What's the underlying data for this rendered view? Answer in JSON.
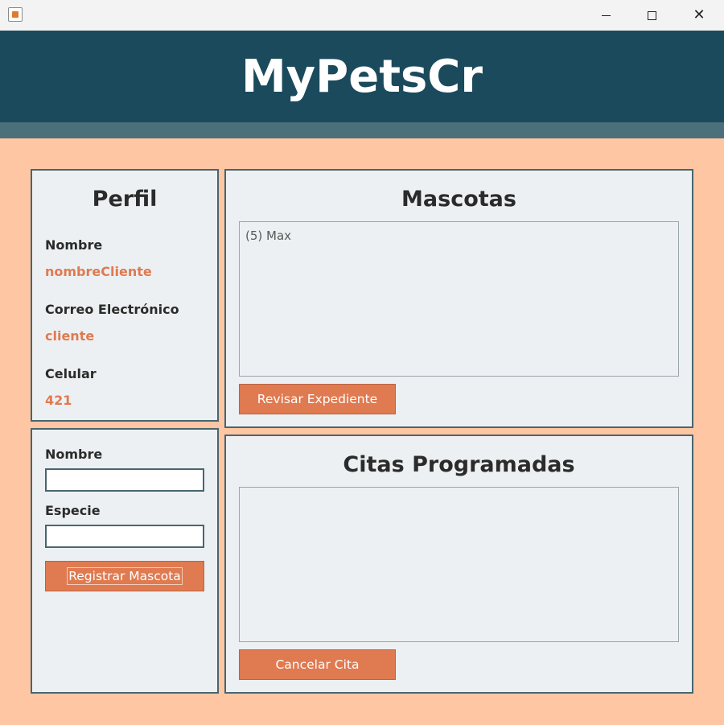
{
  "window": {
    "minimize_icon": "minimize-icon",
    "maximize_icon": "maximize-icon",
    "close_icon": "close-icon",
    "close_glyph": "✕"
  },
  "header": {
    "title": "MyPetsCr"
  },
  "profile": {
    "title": "Perfil",
    "name_label": "Nombre",
    "name_value": "nombreCliente",
    "email_label": "Correo Electrónico",
    "email_value": "cliente",
    "phone_label": "Celular",
    "phone_value": "421"
  },
  "register": {
    "name_label": "Nombre",
    "name_value": "",
    "species_label": "Especie",
    "species_value": "",
    "button_label": "Registrar Mascota"
  },
  "pets": {
    "title": "Mascotas",
    "items": [
      "(5) Max"
    ],
    "button_label": "Revisar Expediente"
  },
  "appointments": {
    "title": "Citas Programadas",
    "items": [],
    "button_label": "Cancelar Cita"
  },
  "colors": {
    "header_bg": "#1b4a5c",
    "accent": "#e07a50",
    "background": "#ffc6a3",
    "panel_bg": "#edf0f2"
  }
}
